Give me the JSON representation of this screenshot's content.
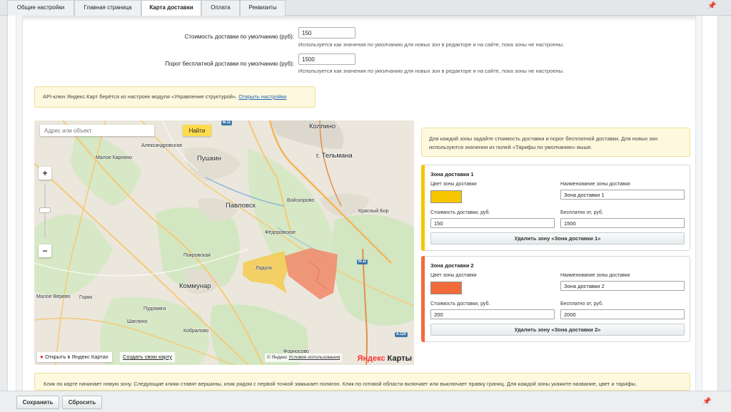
{
  "tabs": [
    {
      "label": "Общие настройки"
    },
    {
      "label": "Главная страница"
    },
    {
      "label": "Карта доставки"
    },
    {
      "label": "Оплата"
    },
    {
      "label": "Реквизиты"
    }
  ],
  "active_tab": "Карта доставки",
  "settings": {
    "default_cost": {
      "label": "Стоимость доставки по умолчанию (руб):",
      "value": "150",
      "hint": "Используется как значения по умолчанию для новых зон в редакторе и на сайте, пока зоны не настроены."
    },
    "free_threshold": {
      "label": "Порог бесплатной доставки по умолчанию (руб):",
      "value": "1500",
      "hint": "Используется как значения по умолчанию для новых зон в редакторе и на сайте, пока зоны не настроены."
    }
  },
  "api_notice": {
    "text": "API-ключ Яндекс.Карт берётся из настроек модуля «Управление структурой». ",
    "link": "Открыть настройки"
  },
  "map": {
    "search_placeholder": "Адрес или объект",
    "find_button": "Найти",
    "zoom_in": "+",
    "zoom_out": "−",
    "open_in_yandex": "Открыть в Яндекс Картах",
    "create_map": "Создать свою карту",
    "copyright": "© Яндекс ",
    "terms": "Условия использования",
    "logo_ya": "Яндекс",
    "logo_maps": " Карты",
    "places": [
      {
        "name": "Колпино"
      },
      {
        "name": "Александровская"
      },
      {
        "name": "Пушкин"
      },
      {
        "name": "г. Тельмана"
      },
      {
        "name": "Малое Карлино"
      },
      {
        "name": "Павловск"
      },
      {
        "name": "Войскорово"
      },
      {
        "name": "Красный Бор"
      },
      {
        "name": "Фёдоровское"
      },
      {
        "name": "Покровская"
      },
      {
        "name": "Ладога"
      },
      {
        "name": "Малое Верево"
      },
      {
        "name": "Горки"
      },
      {
        "name": "Коммунар"
      },
      {
        "name": "Пудомяги"
      },
      {
        "name": "Шаглино"
      },
      {
        "name": "Кобралово"
      },
      {
        "name": "Форносово"
      }
    ],
    "road_shields": [
      "М-11",
      "М-11",
      "А-120"
    ],
    "zones": [
      {
        "color": "#f5d442",
        "opacity": 0.75
      },
      {
        "color": "#f2876a",
        "opacity": 0.8
      }
    ]
  },
  "zones_notice": "Для каждой зоны задайте стоимость доставки и порог бесплатной доставки. Для новых зон используются значения из полей «Тарифы по умолчанию» выше.",
  "zones": [
    {
      "title": "Зона доставки 1",
      "color_label": "Цвет зоны доставки",
      "color": "#f7c600",
      "name_label": "Наименование зоны доставки",
      "name": "Зона доставки 1",
      "cost_label": "Стоимость доставки, руб.",
      "cost": "150",
      "free_label": "Бесплатно от, руб.",
      "free": "1500",
      "delete_label": "Удалить зону «Зона доставки 1»"
    },
    {
      "title": "Зона доставки 2",
      "color_label": "Цвет зоны доставки",
      "color": "#f26b3a",
      "name_label": "Наименование зоны доставки",
      "name": "Зона доставки 2",
      "cost_label": "Стоимость доставки, руб.",
      "cost": "200",
      "free_label": "Бесплатно от, руб.",
      "free": "2000",
      "delete_label": "Удалить зону «Зона доставки 2»"
    }
  ],
  "bottom_notice": "Клик по карте начинает новую зону. Следующие клики ставят вершины, клик рядом с первой точкой замыкает полигон. Клик по готовой области включает или выключает правку границ. Для каждой зоны укажите название, цвет и тарифы.",
  "buttons": {
    "save": "Сохранить",
    "reset": "Сбросить"
  },
  "icons": {
    "pin": "pin-icon",
    "map_pin": "map-marker-icon"
  }
}
